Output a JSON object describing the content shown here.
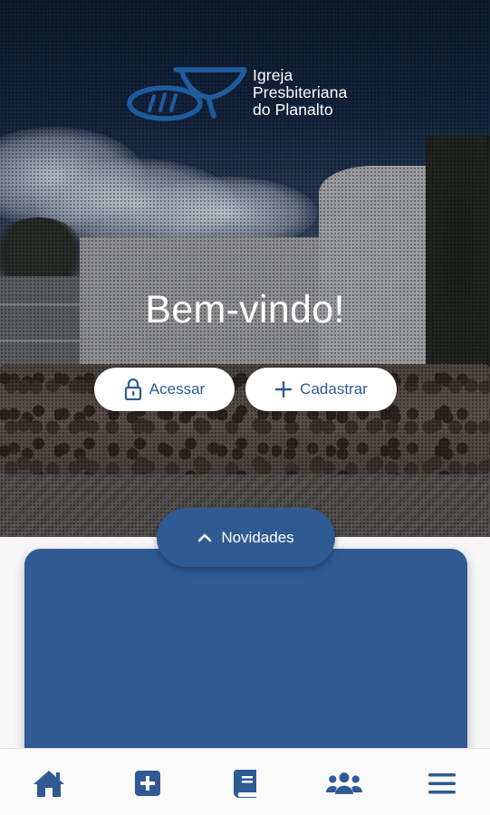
{
  "colors": {
    "primary": "#2f5a92",
    "logo_blue": "#1f5c9e",
    "white": "#ffffff",
    "nav_background": "#fafafa"
  },
  "hero": {
    "logo": {
      "line1": "Igreja",
      "line2": "Presbiteriana",
      "line3": "do Planalto",
      "icon": "bread-and-cup-logo"
    },
    "welcome_text": "Bem-vindo!",
    "buttons": {
      "access_label": "Acessar",
      "access_icon": "lock-icon",
      "register_label": "Cadastrar",
      "register_icon": "plus-icon"
    }
  },
  "news": {
    "tab_label": "Novidades",
    "tab_icon": "chevron-up-icon"
  },
  "bottom_nav": {
    "items": [
      {
        "icon": "home-icon",
        "active": true
      },
      {
        "icon": "plus-square-icon",
        "active": false
      },
      {
        "icon": "book-icon",
        "active": false
      },
      {
        "icon": "users-icon",
        "active": false
      },
      {
        "icon": "menu-icon",
        "active": false
      }
    ]
  }
}
